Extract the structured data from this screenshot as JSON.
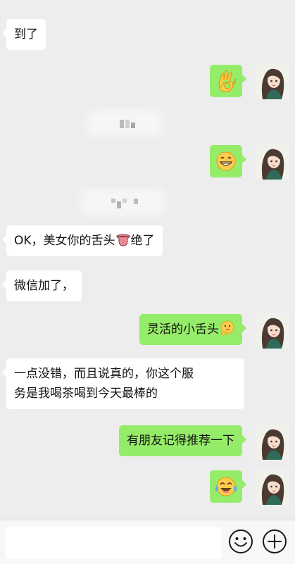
{
  "messages": [
    {
      "side": "in",
      "text": "到了"
    },
    {
      "side": "out",
      "emoji": "ok-hand"
    },
    {
      "side": "out",
      "emoji": "grin"
    },
    {
      "side": "in",
      "text_a": "OK，美女你的舌头",
      "text_b": "绝了",
      "inline_emoji": "tongue"
    },
    {
      "side": "in",
      "text": "微信加了，"
    },
    {
      "side": "out",
      "text": "灵活的小舌头",
      "inline_emoji": "thinking"
    },
    {
      "side": "in",
      "line1": "一点没错，而且说真的，你这个服",
      "line2": "务是我喝茶喝到今天最棒的"
    },
    {
      "side": "out",
      "text": "有朋友记得推荐一下"
    },
    {
      "side": "out",
      "emoji": "tears-of-joy"
    }
  ],
  "input_bar": {
    "placeholder": "",
    "emoji_button_icon": "smiley-icon",
    "more_button_icon": "plus-circle-icon"
  },
  "colors": {
    "background": "#ededed",
    "incoming_bubble": "#ffffff",
    "outgoing_bubble": "#95ec69",
    "input_bar": "#f7f7f7"
  }
}
